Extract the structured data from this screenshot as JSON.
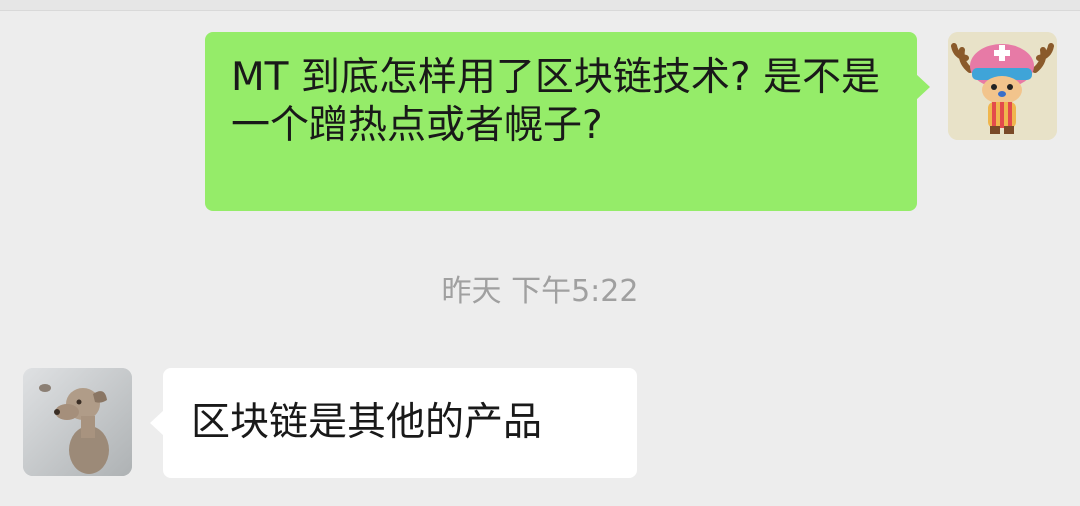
{
  "messages": [
    {
      "sender": "me",
      "avatar": "chopper-avatar",
      "text": "MT 到底怎样用了区块链技术? 是不是一个蹭热点或者幌子?"
    },
    {
      "sender": "other",
      "avatar": "dog-avatar",
      "text": "区块链是其他的产品"
    }
  ],
  "timestamp": "昨天 下午5:22",
  "colors": {
    "chat_background": "#ededed",
    "outgoing_bubble": "#95ec69",
    "incoming_bubble": "#ffffff",
    "timestamp_text": "#a0a0a0"
  }
}
